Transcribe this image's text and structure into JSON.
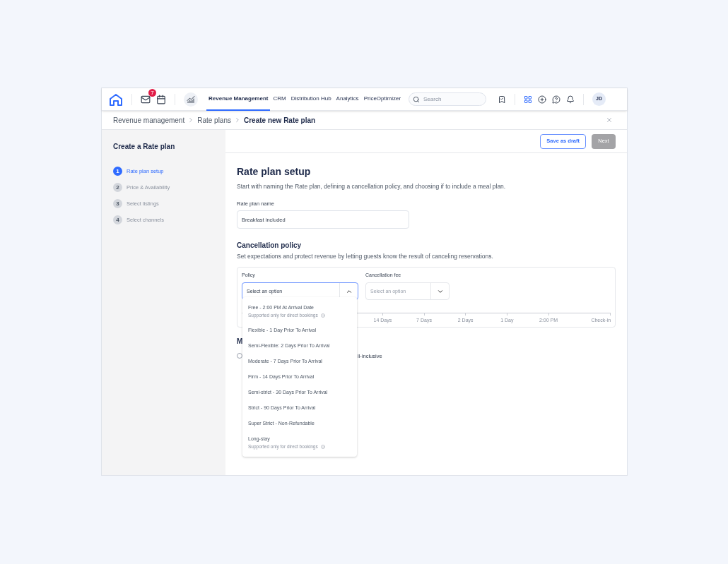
{
  "nav": {
    "mail_badge": "7",
    "links": [
      {
        "label": "Revenue Management",
        "selected": true
      },
      {
        "label": "CRM",
        "selected": false
      },
      {
        "label": "Distribution Hub",
        "selected": false
      },
      {
        "label": "Analytics",
        "selected": false
      },
      {
        "label": "PriceOptimizer",
        "selected": false
      }
    ],
    "search": {
      "placeholder": "Search"
    },
    "avatar": "JD"
  },
  "breadcrumb": [
    {
      "label": "Revenue management",
      "current": false
    },
    {
      "label": "Rate plans",
      "current": false
    },
    {
      "label": "Create new Rate plan",
      "current": true
    }
  ],
  "sidebar": {
    "title": "Create a Rate plan",
    "steps": [
      {
        "number": "1",
        "label": "Rate plan setup",
        "selected": true
      },
      {
        "number": "2",
        "label": "Price & Availability",
        "selected": false
      },
      {
        "number": "3",
        "label": "Select listings",
        "selected": false
      },
      {
        "number": "4",
        "label": "Select channels",
        "selected": false
      }
    ]
  },
  "actions": {
    "save": "Save as draft",
    "next": {
      "label": "Next",
      "disabled": true
    }
  },
  "content": {
    "title": "Rate plan setup",
    "description": "Start with naming the Rate plan, defining a cancellation policy, and choosing if to include a meal plan.",
    "name_field": {
      "label": "Rate plan name",
      "value": "Breakfast included"
    },
    "cancellation": {
      "title": "Cancellation policy",
      "description": "Set expectations and protect revenue by letting guests know the result of canceling reservations.",
      "policy": {
        "label": "Policy",
        "value": "Select an option",
        "expanded": true
      },
      "fee": {
        "label": "Cancellation fee",
        "placeholder": "Select an option",
        "expanded": false
      },
      "timeline": [
        "14 Days",
        "7 Days",
        "2 Days",
        "1 Day",
        "2:00 PM",
        "Check-in"
      ]
    },
    "meal": {
      "title": "M",
      "option": {
        "label": "ll-inclusive",
        "checked": false
      }
    }
  },
  "dropdown": [
    {
      "label": "Free - 2:00 PM At Arrival Date",
      "note": "Supported only for direct bookings"
    },
    {
      "label": "Flexible - 1 Day Prior To Arrival"
    },
    {
      "label": "Semi-Flexible: 2 Days Prior To Arrival"
    },
    {
      "label": "Moderate - 7 Days Prior To Arrival"
    },
    {
      "label": "Firm - 14 Days Prior To Arrival"
    },
    {
      "label": "Semi-strict - 30 Days Prior To Arrival"
    },
    {
      "label": "Strict - 90 Days Prior To Arrival"
    },
    {
      "label": "Super Strict - Non-Refundable"
    },
    {
      "label": "Long-stay",
      "note": "Supported only for direct bookings"
    }
  ]
}
